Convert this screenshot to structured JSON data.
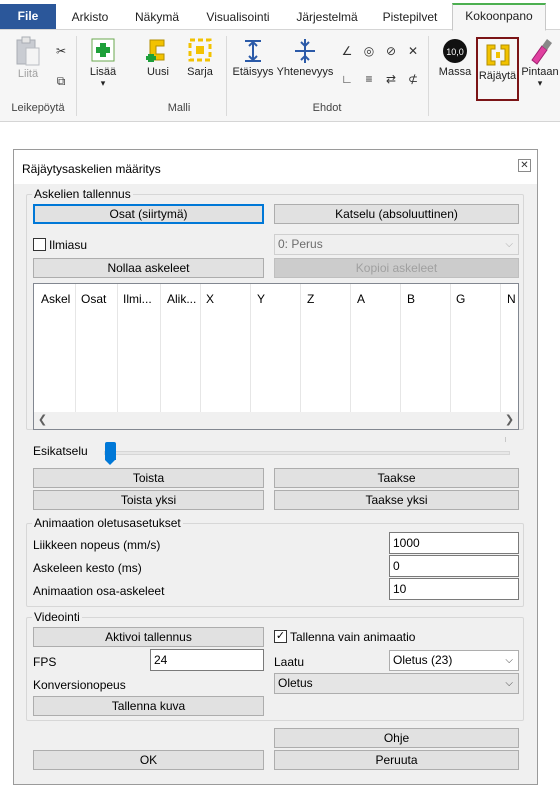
{
  "ribbon": {
    "tabs": [
      "File",
      "Arkisto",
      "Näkymä",
      "Visualisointi",
      "Järjestelmä",
      "Pistepilvet",
      "Kokoonpano"
    ],
    "active_tab": "Kokoonpano",
    "groups": {
      "clipboard": {
        "label": "Leikepöytä",
        "paste": "Liitä"
      },
      "model": {
        "label": "Malli",
        "add": "Lisää",
        "new": "Uusi",
        "series": "Sarja"
      },
      "constraints": {
        "label": "Ehdot",
        "distance": "Etäisyys",
        "coincidence": "Yhtenevyys"
      },
      "tools": {
        "mass": "Massa",
        "mass_icon_text": "10,0",
        "explode": "Räjäytä",
        "paint": "Pintaan"
      }
    }
  },
  "dialog": {
    "title": "Räjäytysaskelien määritys",
    "save_steps": {
      "legend": "Askelien tallennus",
      "parts_button": "Osat (siirtymä)",
      "view_button": "Katselu (absoluuttinen)",
      "visible_label": "Ilmiasu",
      "visible_checked": false,
      "base_select": "0: Perus",
      "reset_button": "Nollaa askeleet",
      "copy_button": "Kopioi askeleet",
      "columns": [
        "Askel",
        "Osat",
        "Ilmi...",
        "Alik...",
        "X",
        "Y",
        "Z",
        "A",
        "B",
        "G",
        "N"
      ]
    },
    "preview": {
      "label": "Esikatselu",
      "position": 0,
      "play_button": "Toista",
      "back_button": "Taakse",
      "play_one_button": "Toista yksi",
      "back_one_button": "Taakse yksi"
    },
    "animation": {
      "legend": "Animaation oletusasetukset",
      "speed_label": "Liikkeen nopeus (mm/s)",
      "speed_value": "1000",
      "duration_label": "Askeleen kesto (ms)",
      "duration_value": "0",
      "substeps_label": "Animaation osa-askeleet",
      "substeps_value": "10"
    },
    "video": {
      "legend": "Videointi",
      "record_button": "Aktivoi tallennus",
      "animation_only_label": "Tallenna vain animaatio",
      "animation_only_checked": true,
      "fps_label": "FPS",
      "fps_value": "24",
      "quality_label": "Laatu",
      "quality_value": "Oletus (23)",
      "conversion_label": "Konversionopeus",
      "conversion_value": "Oletus",
      "save_image_button": "Tallenna kuva"
    },
    "help_button": "Ohje",
    "ok_button": "OK",
    "cancel_button": "Peruuta"
  }
}
